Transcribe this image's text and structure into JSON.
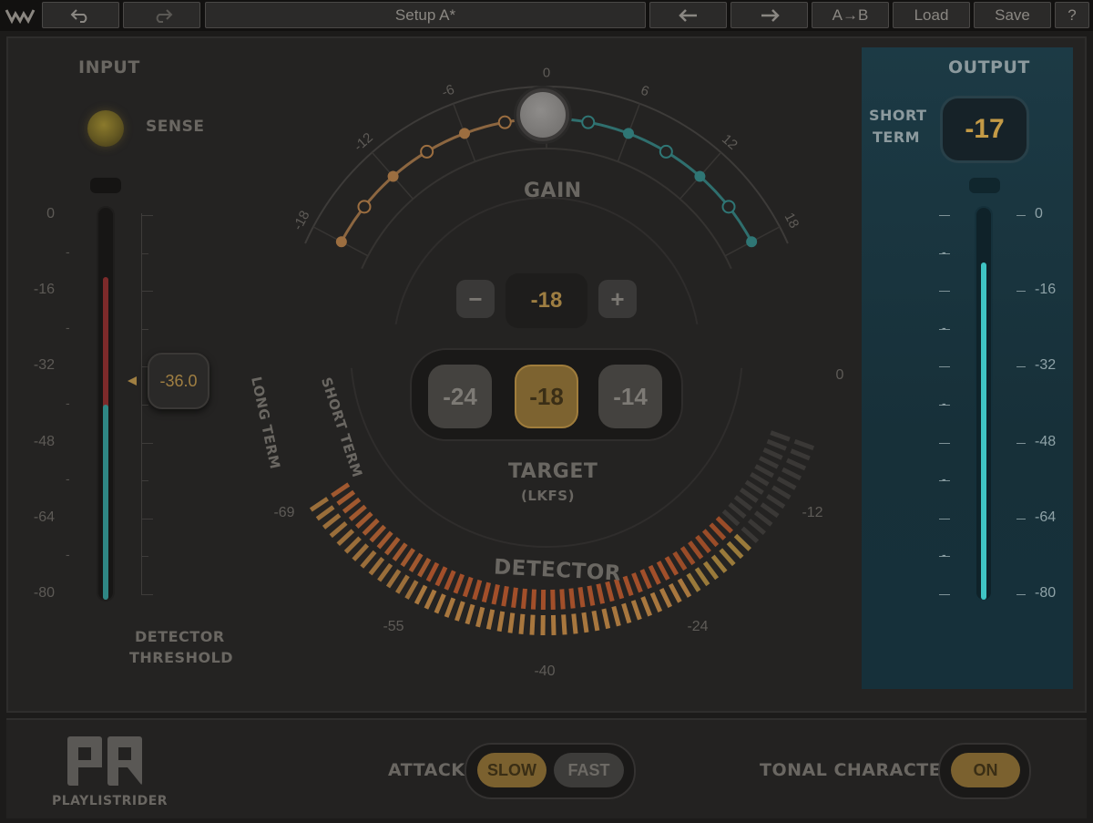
{
  "toolbar": {
    "logo_icon": "waves-logo-icon",
    "undo_icon": "undo-icon",
    "redo_icon": "redo-icon",
    "preset_name": "Setup A*",
    "prev_icon": "arrow-left-icon",
    "next_icon": "arrow-right-icon",
    "ab_label": "A→B",
    "load_label": "Load",
    "save_label": "Save",
    "help_label": "?"
  },
  "input": {
    "title": "INPUT",
    "sense_label": "SENSE",
    "scale": [
      "0",
      "-16",
      "-32",
      "-48",
      "-64",
      "-80"
    ],
    "threshold_value": "-36.0",
    "threshold_label_1": "DETECTOR",
    "threshold_label_2": "THRESHOLD",
    "meter_level_db": -40,
    "meter_peak_db": -13
  },
  "gain": {
    "title": "GAIN",
    "scale": [
      "-18",
      "-12",
      "-6",
      "0",
      "6",
      "12",
      "18"
    ],
    "current_db": 0,
    "value": "-18",
    "minus_label": "−",
    "plus_label": "+"
  },
  "target": {
    "options": [
      "-24",
      "-18",
      "-14"
    ],
    "selected": "-18",
    "label": "TARGET",
    "unit": "(LKFS)"
  },
  "detector": {
    "title": "DETECTOR",
    "long_term_label": "LONG TERM",
    "short_term_label": "SHORT TERM",
    "scale": [
      "0",
      "-12",
      "-24",
      "-40",
      "-55",
      "-69"
    ]
  },
  "output": {
    "title": "OUTPUT",
    "short_term_label_1": "SHORT",
    "short_term_label_2": "TERM",
    "short_term_value": "-17",
    "scale": [
      "0",
      "-16",
      "-32",
      "-48",
      "-64",
      "-80"
    ],
    "meter_level_db": -10
  },
  "bottom": {
    "product_name": "PLAYLISTRIDER",
    "attack_label": "ATTACK",
    "attack_options": [
      "SLOW",
      "FAST"
    ],
    "attack_selected": "SLOW",
    "tonal_label": "TONAL CHARACTER",
    "tonal_value": "ON"
  },
  "colors": {
    "accent_gold": "#a07f42",
    "teal": "#3ab8b8",
    "meter_red": "#8a2c2c",
    "output_panel": "#1c3a45"
  }
}
